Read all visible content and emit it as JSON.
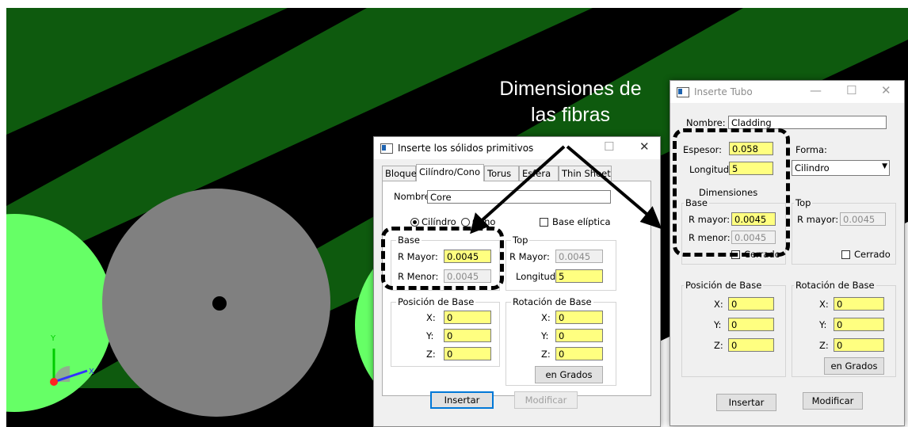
{
  "annotation": {
    "line1": "Dimensiones de",
    "line2": "las fibras"
  },
  "viewport": {
    "axis_y_label": "Y",
    "axis_x_label": "X",
    "colors": {
      "fiber_green": "#005f00",
      "cladding_light": "#66ff66",
      "core_gray": "#808080"
    }
  },
  "dialog_primitives": {
    "title": "Inserte los sólidos primitivos",
    "tabs": [
      "Bloque",
      "Cilíndro/Cono",
      "Torus",
      "Esfera",
      "Thin Sheet"
    ],
    "active_tab": "Cilíndro/Cono",
    "nombre_label": "Nombre:",
    "nombre_value": "Core",
    "radio_cilindro": "Cilíndro",
    "radio_cono": "Cono",
    "base_eliptica": "Base elíptica",
    "base_group": "Base",
    "top_group": "Top",
    "r_mayor_label": "R Mayor:",
    "r_menor_label": "R Menor:",
    "base_r_mayor": "0.0045",
    "base_r_menor": "0.0045",
    "top_r_mayor": "0.0045",
    "longitud_label": "Longitud",
    "longitud_value": "5",
    "posicion_group": "Posición de Base",
    "rotacion_group": "Rotación de Base",
    "x_label": "X:",
    "y_label": "Y:",
    "z_label": "Z:",
    "pos_x": "0",
    "pos_y": "0",
    "pos_z": "0",
    "rot_x": "0",
    "rot_y": "0",
    "rot_z": "0",
    "en_grados": "en Grados",
    "insertar": "Insertar",
    "modificar": "Modificar"
  },
  "dialog_tubo": {
    "title": "Inserte Tubo",
    "nombre_label": "Nombre:",
    "nombre_value": "Cladding",
    "espesor_label": "Espesor:",
    "espesor_value": "0.058",
    "longitud_label": "Longitud",
    "longitud_value": "5",
    "forma_label": "Forma:",
    "forma_value": "Cilindro",
    "dimensiones_label": "Dimensiones",
    "base_group": "Base",
    "top_group": "Top",
    "r_mayor_label": "R mayor:",
    "r_menor_label": "R menor:",
    "base_r_mayor": "0.0045",
    "base_r_menor": "0.0045",
    "top_r_mayor": "0.0045",
    "cerrado_label": "Cerrado",
    "posicion_group": "Posición de Base",
    "rotacion_group": "Rotación de Base",
    "x_label": "X:",
    "y_label": "Y:",
    "z_label": "Z:",
    "pos_x": "0",
    "pos_y": "0",
    "pos_z": "0",
    "rot_x": "0",
    "rot_y": "0",
    "rot_z": "0",
    "en_grados": "en Grados",
    "insertar": "Insertar",
    "modificar": "Modificar"
  }
}
